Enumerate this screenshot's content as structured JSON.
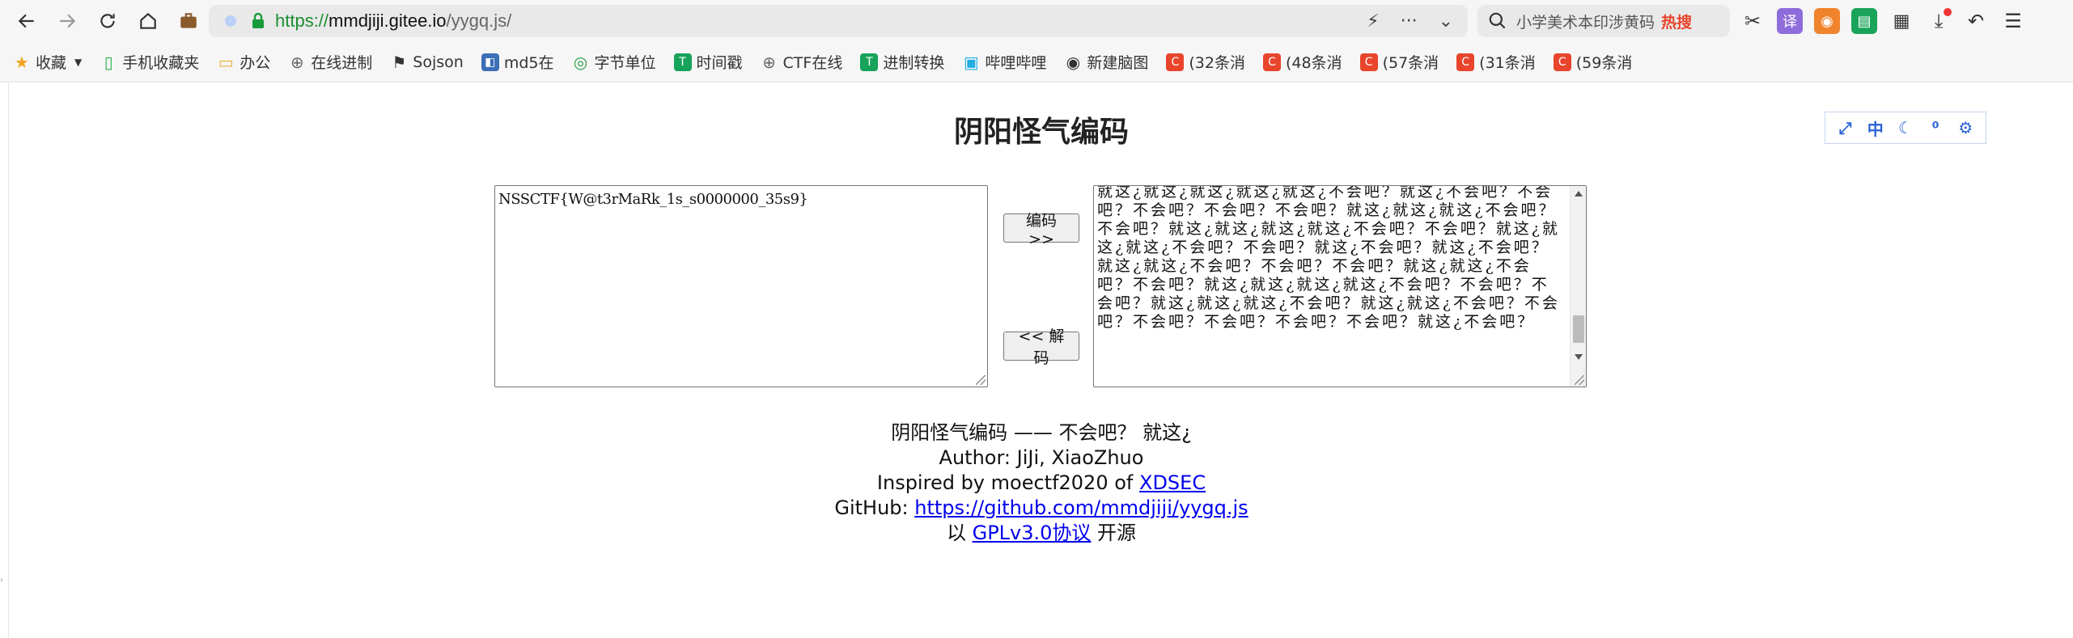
{
  "browser": {
    "url": {
      "scheme": "https://",
      "host": "mmdjiji.gitee.io",
      "path": "/yygq.js/"
    },
    "search": {
      "query": "小学美术本印涉黄码",
      "hot_label": "热搜"
    },
    "bookmarks": [
      {
        "label": "收藏",
        "icon": "star-icon",
        "color": "#f2a31b"
      },
      {
        "label": "手机收藏夹",
        "icon": "phone-icon",
        "color": "#2bb24c"
      },
      {
        "label": "办公",
        "icon": "folder-icon",
        "color": "#e8b339"
      },
      {
        "label": "在线进制",
        "icon": "globe-icon",
        "color": "#666666"
      },
      {
        "label": "Sojson",
        "icon": "flag-icon",
        "color": "#333333"
      },
      {
        "label": "md5在",
        "icon": "md5-icon",
        "color": "#3c6fb5"
      },
      {
        "label": "字节单位",
        "icon": "swirl-icon",
        "color": "#2a9d4a"
      },
      {
        "label": "时间戳",
        "icon": "t-icon",
        "color": "#17a35a"
      },
      {
        "label": "CTF在线",
        "icon": "globe-icon",
        "color": "#666666"
      },
      {
        "label": "进制转换",
        "icon": "t-icon",
        "color": "#17a35a"
      },
      {
        "label": "哔哩哔哩",
        "icon": "bilibili-icon",
        "color": "#23ade5"
      },
      {
        "label": "新建脑图",
        "icon": "owl-icon",
        "color": "#333333"
      },
      {
        "label": "(32条消",
        "icon": "csdn-icon",
        "color": "#e8452c"
      },
      {
        "label": "(48条消",
        "icon": "csdn-icon",
        "color": "#e8452c"
      },
      {
        "label": "(57条消",
        "icon": "csdn-icon",
        "color": "#e8452c"
      },
      {
        "label": "(31条消",
        "icon": "csdn-icon",
        "color": "#e8452c"
      },
      {
        "label": "(59条消",
        "icon": "csdn-icon",
        "color": "#e8452c"
      }
    ]
  },
  "page": {
    "title": "阴阳怪气编码",
    "mini_tools": [
      {
        "name": "screenshot-icon",
        "glyph": "⤢"
      },
      {
        "name": "chinese-icon",
        "glyph": "中"
      },
      {
        "name": "moon-icon",
        "glyph": "☾"
      },
      {
        "name": "voice-icon",
        "glyph": "⁰"
      },
      {
        "name": "gear-icon",
        "glyph": "⚙"
      }
    ],
    "input_text": "NSSCTF{W@t3rMaRk_1s_s0000000_35s9}",
    "output_text": "就这¿就这¿就这¿就这¿就这¿不会吧？就这¿不会吧？不会吧？不会吧？不会吧？不会吧？就这¿就这¿就这¿不会吧？不会吧？就这¿就这¿就这¿就这¿不会吧？不会吧？就这¿就这¿就这¿不会吧？不会吧？就这¿不会吧？就这¿不会吧？就这¿就这¿不会吧？不会吧？不会吧？就这¿就这¿不会吧？不会吧？就这¿就这¿就这¿就这¿不会吧？不会吧？不会吧？就这¿就这¿就这¿不会吧？就这¿就这¿不会吧？不会吧？不会吧？不会吧？不会吧？不会吧？就这¿不会吧？",
    "encode_label": "编码 >>",
    "decode_label": "<< 解码",
    "footer": {
      "line1": "阴阳怪气编码 —— 不会吧？ 就这¿",
      "line2": "Author: JiJi, XiaoZhuo",
      "line3_prefix": "Inspired by moectf2020 of ",
      "line3_link": "XDSEC",
      "line4_prefix": "GitHub: ",
      "line4_link": "https://github.com/mmdjiji/yygq.js",
      "line5_prefix": "以 ",
      "line5_link": "GPLv3.0协议",
      "line5_suffix": " 开源"
    }
  }
}
